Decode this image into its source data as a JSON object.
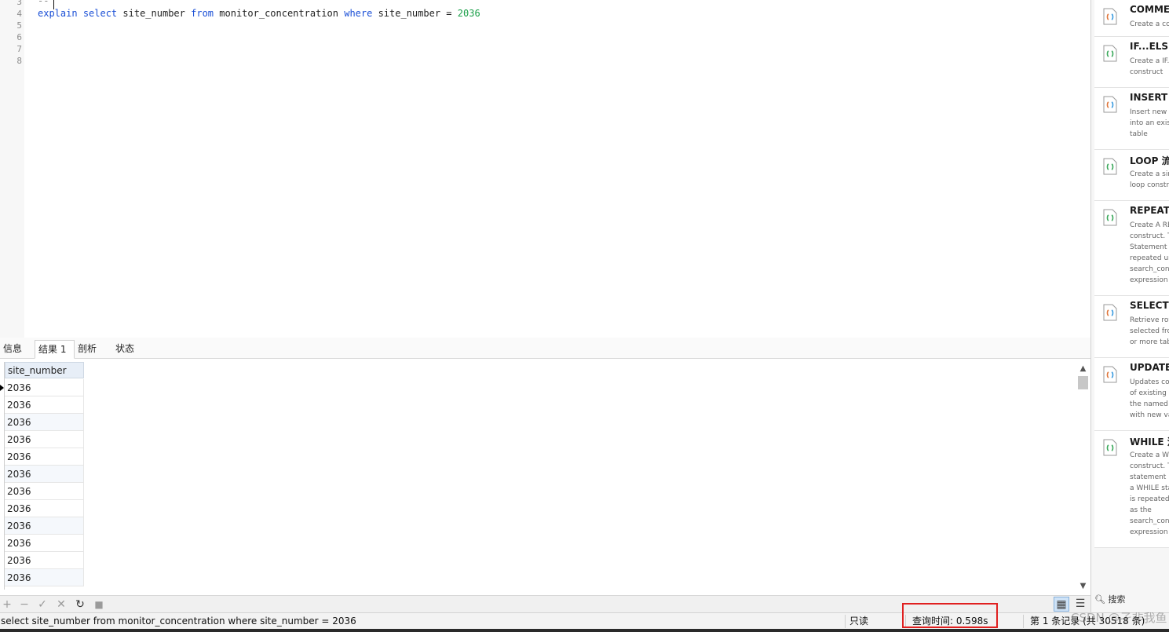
{
  "editor": {
    "lines": [
      {
        "no": "3",
        "text": "-- "
      },
      {
        "no": "4",
        "text": "explain select site_number from monitor_concentration where site_number = 2036"
      },
      {
        "no": "5",
        "text": ""
      },
      {
        "no": "6",
        "text": ""
      },
      {
        "no": "7",
        "text": ""
      },
      {
        "no": "8",
        "text": ""
      }
    ],
    "sql_tokens": {
      "explain": "explain",
      "select": "select",
      "col": "site_number",
      "from": "from",
      "table": "monitor_concentration",
      "where": "where",
      "col2": "site_number",
      "eq": "=",
      "value": "2036"
    }
  },
  "results": {
    "tabs": [
      "信息",
      "结果 1",
      "剖析",
      "状态"
    ],
    "active_tab": "结果 1",
    "column": "site_number",
    "rows": [
      "2036",
      "2036",
      "2036",
      "2036",
      "2036",
      "2036",
      "2036",
      "2036",
      "2036",
      "2036",
      "2036",
      "2036"
    ]
  },
  "gridbar": {
    "buttons": [
      "add-icon",
      "remove-icon",
      "apply-icon",
      "cancel-icon",
      "refresh-icon",
      "stop-icon"
    ],
    "glyphs": [
      "+",
      "−",
      "✓",
      "✕",
      "↻",
      "■"
    ]
  },
  "statusbar": {
    "query": "select site_number from monitor_concentration where site_number = 2036",
    "readonly": "只读",
    "query_time": "查询时间: 0.598s",
    "record_info": "第 1 条记录 (共 30518 条)"
  },
  "watermark": "CSDN @孑非我鱼",
  "snippets": [
    {
      "title": "COMME",
      "desc": "Create a co"
    },
    {
      "title": "IF...ELSE.",
      "desc": "Create a IF...\nconstruct"
    },
    {
      "title": "INSERT S",
      "desc": "Insert new r\ninto an exis\ntable"
    },
    {
      "title": "LOOP 流",
      "desc": "Create a sim\nloop constr"
    },
    {
      "title": "REPEAT",
      "desc": "Create A RE\nconstruct. T\nStatement li\nrepeated ur\nsearch_con\nexpression i"
    },
    {
      "title": "SELECT S",
      "desc": "Retrieve row\nselected fro\nor more tab"
    },
    {
      "title": "UPDATE",
      "desc": "Updates co\nof existing r\nthe named\nwith new va"
    },
    {
      "title": "WHILE 流",
      "desc": "Create a WH\nconstruct. T\nstatement li\na WHILE sta\nis repeated\nas the\nsearch_con\nexpression i"
    }
  ],
  "panel_search": "搜索",
  "colors": {
    "keyword": "#1a4fd6",
    "number": "#1ca04a",
    "highlight_box": "#e02020",
    "header_bg": "#e7eef7"
  }
}
